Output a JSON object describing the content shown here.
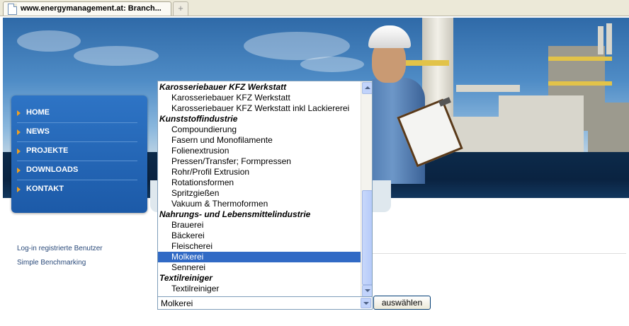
{
  "browser": {
    "tab_title": "www.energymanagement.at: Branch...",
    "new_tab_symbol": "+"
  },
  "nav": {
    "bullet_color": "#f0a020",
    "items": [
      {
        "label": "HOME"
      },
      {
        "label": "NEWS"
      },
      {
        "label": "PROJEKTE"
      },
      {
        "label": "DOWNLOADS"
      },
      {
        "label": "KONTAKT"
      }
    ]
  },
  "content": {
    "login_link": "Log-in registrierte Benutzer",
    "benchmark_link": "Simple Benchmarking"
  },
  "dropdown": {
    "options": [
      {
        "text": "Karosseriebauer KFZ Werkstatt",
        "group": true
      },
      {
        "text": "Karosseriebauer KFZ Werkstatt",
        "group": false
      },
      {
        "text": "Karosseriebauer KFZ Werkstatt inkl Lackiererei",
        "group": false
      },
      {
        "text": "Kunststoffindustrie",
        "group": true
      },
      {
        "text": "Compoundierung",
        "group": false
      },
      {
        "text": "Fasern und Monofilamente",
        "group": false
      },
      {
        "text": "Folienextrusion",
        "group": false
      },
      {
        "text": "Pressen/Transfer; Formpressen",
        "group": false
      },
      {
        "text": "Rohr/Profil Extrusion",
        "group": false
      },
      {
        "text": "Rotationsformen",
        "group": false
      },
      {
        "text": "Spritzgießen",
        "group": false
      },
      {
        "text": "Vakuum & Thermoformen",
        "group": false
      },
      {
        "text": "Nahrungs- und Lebensmittelindustrie",
        "group": true
      },
      {
        "text": "Brauerei",
        "group": false
      },
      {
        "text": "Bäckerei",
        "group": false
      },
      {
        "text": "Fleischerei",
        "group": false
      },
      {
        "text": "Molkerei",
        "group": false,
        "selected": true
      },
      {
        "text": "Sennerei",
        "group": false
      },
      {
        "text": "Textilreiniger",
        "group": true
      },
      {
        "text": "Textilreiniger",
        "group": false
      }
    ],
    "selection_color": "#316ac5"
  },
  "select": {
    "value": "Molkerei"
  },
  "submit_label": "auswählen"
}
